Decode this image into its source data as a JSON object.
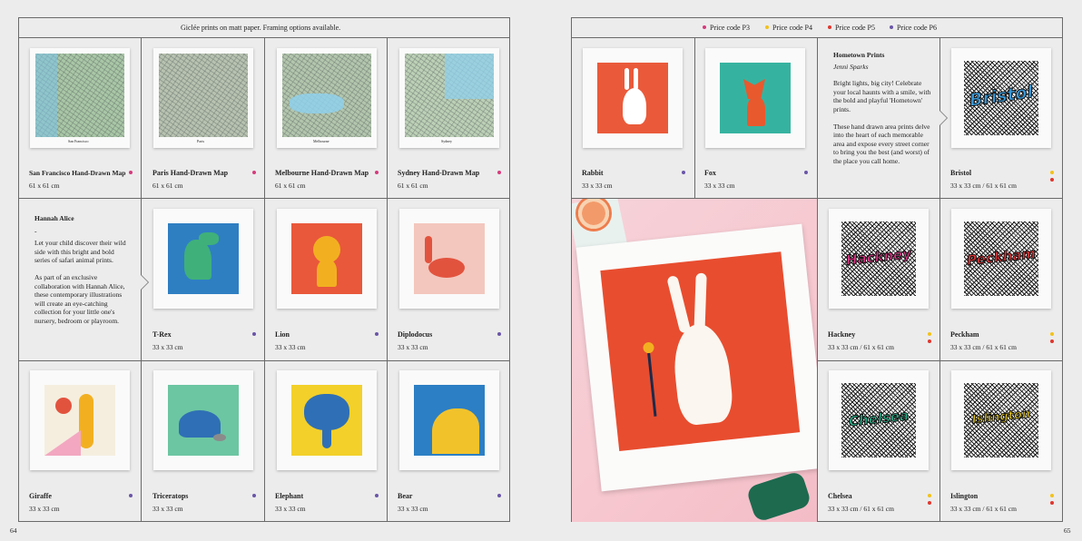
{
  "left_page": {
    "header": "Giclée prints on matt paper.    Framing options available.",
    "page_number": "64",
    "maps": [
      {
        "title": "San Francisco Hand-Drawn Map",
        "size": "61 x 61 cm",
        "caption": "San Francisco"
      },
      {
        "title": "Paris Hand-Drawn Map",
        "size": "61 x 61 cm",
        "caption": "Paris"
      },
      {
        "title": "Melbourne Hand-Drawn Map",
        "size": "61 x 61 cm",
        "caption": "Melbourne"
      },
      {
        "title": "Sydney Hand-Drawn Map",
        "size": "61 x 61 cm",
        "caption": "Sydney"
      }
    ],
    "collection": {
      "heading": "Hannah Alice",
      "dash": "-",
      "para1": "Let your child discover their wild side with this bright and bold series of safari animal prints.",
      "para2": "As part of an exclusive collaboration with Hannah Alice, these contemporary illustrations will create an eye-catching collection for your little one's nursery, bedroom or playroom."
    },
    "animals_row2": [
      {
        "title": "T-Rex",
        "size": "33 x 33 cm"
      },
      {
        "title": "Lion",
        "size": "33 x 33 cm"
      },
      {
        "title": "Diplodocus",
        "size": "33 x 33 cm"
      }
    ],
    "animals_row3": [
      {
        "title": "Giraffe",
        "size": "33 x 33 cm"
      },
      {
        "title": "Triceratops",
        "size": "33 x 33 cm"
      },
      {
        "title": "Elephant",
        "size": "33 x 33 cm"
      },
      {
        "title": "Bear",
        "size": "33 x 33 cm"
      }
    ]
  },
  "right_page": {
    "page_number": "65",
    "legend": [
      {
        "label": "Price code P3",
        "color": "#d63a7c"
      },
      {
        "label": "Price code P4",
        "color": "#f2c21b"
      },
      {
        "label": "Price code P5",
        "color": "#e0372e"
      },
      {
        "label": "Price code P6",
        "color": "#6a55a8"
      }
    ],
    "prints": [
      {
        "title": "Rabbit",
        "size": "33 x 33 cm"
      },
      {
        "title": "Fox",
        "size": "33 x 33 cm"
      }
    ],
    "hometown": {
      "heading": "Hometown Prints",
      "author": "Jenni Sparks",
      "para1": "Bright lights, big city! Celebrate your local haunts with a smile, with the bold and playful 'Hometown' prints.",
      "para2": "These hand drawn area prints delve into the heart of each memorable area and expose every street corner to bring you the best (and worst) of the place you call home."
    },
    "towns": [
      {
        "title": "Bristol",
        "size": "33 x 33 cm / 61 x 61 cm",
        "word": "Bristol",
        "color": "#3a9ad9"
      },
      {
        "title": "Hackney",
        "size": "33 x 33 cm / 61 x 61 cm",
        "word": "Hackney",
        "color": "#e2388a"
      },
      {
        "title": "Peckham",
        "size": "33 x 33 cm / 61 x 61 cm",
        "word": "Peckham",
        "color": "#e0373a"
      },
      {
        "title": "Chelsea",
        "size": "33 x 33 cm / 61 x 61 cm",
        "word": "Chelsea",
        "color": "#2bb38a"
      },
      {
        "title": "Islington",
        "size": "33 x 33 cm / 61 x 61 cm",
        "word": "Islington",
        "color": "#f2d21b"
      }
    ]
  },
  "colors": {
    "p3": "#d63a7c",
    "p4": "#f2c21b",
    "p5": "#e0372e",
    "p6": "#6a55a8",
    "border": "#6a6a6a",
    "paper": "#ececec"
  }
}
